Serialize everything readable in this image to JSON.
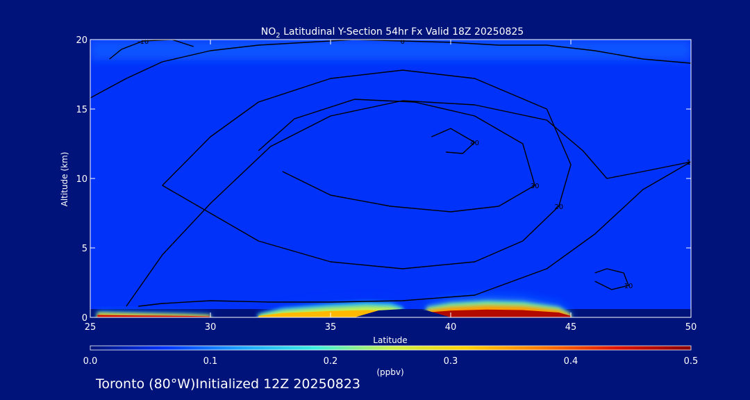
{
  "chart_data": {
    "type": "heatmap",
    "title_prefix": "NO",
    "title_subscript": "2",
    "title_suffix": " Latitudinal Y-Section 54hr  Fx Valid 18Z 20250825",
    "xlabel": "Latitude",
    "ylabel": "Altitude (km)",
    "xlim": [
      25,
      50
    ],
    "ylim": [
      0,
      20
    ],
    "x_ticks": [
      "25",
      "30",
      "35",
      "40",
      "45",
      "50"
    ],
    "y_ticks": [
      "0",
      "5",
      "10",
      "15",
      "20"
    ],
    "colorbar": {
      "unit": "(ppbv)",
      "range": [
        0.0,
        0.5
      ],
      "tick_labels": [
        "0.0",
        "0.1",
        "0.2",
        "0.3",
        "0.4",
        "0.5"
      ],
      "colors": [
        "#00137a",
        "#0033ff",
        "#1ea3ff",
        "#3cf0e0",
        "#c8f04a",
        "#ffd200",
        "#ff7a00",
        "#e01400",
        "#8a0000"
      ]
    },
    "background_no2": [
      {
        "lat_range": [
          25,
          50
        ],
        "alt_range": [
          0.6,
          20
        ],
        "value": 0.06
      },
      {
        "lat_range": [
          25,
          50
        ],
        "alt_range": [
          18.5,
          20
        ],
        "value": 0.08
      }
    ],
    "surface_plumes": [
      {
        "lat": [
          25.3,
          26,
          27,
          28,
          29,
          30
        ],
        "alt": [
          0.5,
          0.45,
          0.4,
          0.35,
          0.3,
          0.2
        ],
        "value": 0.45
      },
      {
        "lat": [
          32,
          33,
          35,
          36.5,
          37.5,
          38
        ],
        "alt": [
          0.3,
          0.9,
          1.3,
          1.5,
          1.4,
          1.0
        ],
        "value": 0.33
      },
      {
        "lat": [
          39,
          40,
          41.5,
          43,
          44.5,
          45
        ],
        "alt": [
          1.0,
          1.4,
          1.6,
          1.5,
          1.0,
          0.3
        ],
        "value": 0.47
      }
    ],
    "contour_labels": [
      "-10",
      "0",
      "10",
      "20",
      "30"
    ],
    "contour_levels": [
      {
        "level": "0",
        "lat": [
          25,
          26.5,
          28,
          30,
          32,
          34,
          36,
          38,
          40,
          42,
          44,
          46,
          48,
          50
        ],
        "alt": [
          15.8,
          17.2,
          18.4,
          19.2,
          19.6,
          19.8,
          20,
          19.9,
          19.8,
          19.6,
          19.6,
          19.2,
          18.6,
          18.3
        ]
      },
      {
        "level": "10",
        "lat": [
          26.5,
          28,
          30,
          32.5,
          35,
          38,
          41,
          44,
          45.5,
          46.5,
          48,
          50,
          48,
          46,
          44,
          41,
          38,
          35,
          32.5,
          30,
          28,
          27
        ],
        "alt": [
          0.8,
          4.5,
          8.2,
          12.3,
          14.5,
          15.6,
          15.3,
          14.2,
          12,
          10,
          10.5,
          11.2,
          9.2,
          6,
          3.5,
          1.6,
          1.2,
          1.1,
          1.1,
          1.2,
          1.0,
          0.8
        ]
      },
      {
        "level": "20",
        "lat": [
          28,
          30,
          32,
          35,
          38,
          41,
          44,
          45,
          44.5,
          43,
          41,
          38,
          35,
          32,
          30,
          28
        ],
        "alt": [
          9.5,
          13,
          15.5,
          17.2,
          17.8,
          17.2,
          15,
          11,
          8,
          5.5,
          4,
          3.5,
          4,
          5.5,
          7.5,
          9.5
        ]
      },
      {
        "level": "30",
        "lat": [
          32,
          33.5,
          36,
          38.5,
          41,
          43,
          43.5,
          42,
          40,
          37.5,
          35,
          33
        ],
        "alt": [
          12,
          14.3,
          15.7,
          15.5,
          14.5,
          12.5,
          9.5,
          8,
          7.6,
          8,
          8.8,
          10.5
        ]
      },
      {
        "level": "40",
        "lat": [
          39.2,
          40,
          41,
          40.5,
          39.8
        ],
        "alt": [
          13,
          13.6,
          12.6,
          11.8,
          11.9
        ]
      },
      {
        "level": "10",
        "lat": [
          46,
          46.5,
          47.2,
          47.4,
          46.7,
          46
        ],
        "alt": [
          3.2,
          3.5,
          3.2,
          2.3,
          2.0,
          2.6
        ]
      },
      {
        "level": "-10",
        "lat": [
          25.8,
          26.3,
          27.2,
          28.4,
          29.3
        ],
        "alt": [
          18.6,
          19.3,
          19.9,
          20,
          19.5
        ]
      }
    ],
    "terrain": {
      "lat": [
        36,
        37,
        38,
        39,
        40
      ],
      "alt": [
        0,
        0.5,
        0.6,
        0.5,
        0
      ]
    }
  },
  "footer_text": "Toronto (80°W)Initialized 12Z 20250823"
}
